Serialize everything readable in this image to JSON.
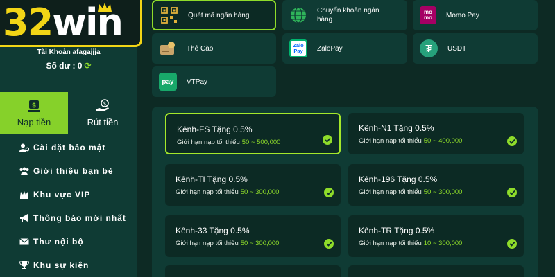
{
  "logo": {
    "part1": "32",
    "part2": "win"
  },
  "account": {
    "name": "Tài Khoản afagajjja",
    "balance_label": "Số dư : 0",
    "refresh_glyph": "⟳"
  },
  "tabs": {
    "deposit": "Nạp tiền",
    "withdraw": "Rút tiền"
  },
  "menu": [
    {
      "label": "Cài đặt bảo mật",
      "icon": "user-gear-icon"
    },
    {
      "label": "Giới thiệu bạn bè",
      "icon": "users-icon"
    },
    {
      "label": "Khu vực VIP",
      "icon": "vip-crown-icon"
    },
    {
      "label": "Thông báo mới nhất",
      "icon": "megaphone-icon"
    },
    {
      "label": "Thư nội bộ",
      "icon": "envelope-icon"
    },
    {
      "label": "Khu sự kiện",
      "icon": "trophy-icon"
    }
  ],
  "payment_methods": [
    {
      "label": "Quét mã ngân hàng",
      "icon": "qr-code-icon",
      "selected": true
    },
    {
      "label": "Chuyển khoản ngân hàng",
      "icon": "globe-icon",
      "selected": false
    },
    {
      "label": "Momo Pay",
      "icon": "momo-icon",
      "icon_text": "mo mo",
      "selected": false
    },
    {
      "label": "Thẻ Cào",
      "icon": "scratch-card-icon",
      "selected": false
    },
    {
      "label": "ZaloPay",
      "icon": "zalopay-icon",
      "icon_text": "Zalo Pay",
      "selected": false
    },
    {
      "label": "USDT",
      "icon": "tether-icon",
      "icon_text": "₮",
      "selected": false
    },
    {
      "label": "VTPay",
      "icon": "vtpay-icon",
      "icon_text": "pay",
      "selected": false
    }
  ],
  "channels": [
    {
      "title": "Kênh-FS Tặng 0.5%",
      "limit_label": "Giới hạn nạp tối thiểu",
      "range": "50 ~ 500,000",
      "selected": true
    },
    {
      "title": "Kênh-N1 Tặng 0.5%",
      "limit_label": "Giới hạn nạp tối thiểu",
      "range": "50 ~ 400,000",
      "selected": false
    },
    {
      "title": "Kênh-TI Tặng 0.5%",
      "limit_label": "Giới hạn nạp tối thiểu",
      "range": "50 ~ 300,000",
      "selected": false
    },
    {
      "title": "Kênh-196 Tặng 0.5%",
      "limit_label": "Giới hạn nạp tối thiểu",
      "range": "50 ~ 300,000",
      "selected": false
    },
    {
      "title": "Kênh-33 Tặng 0.5%",
      "limit_label": "Giới hạn nạp tối thiểu",
      "range": "50 ~ 300,000",
      "selected": false
    },
    {
      "title": "Kênh-TR Tặng 0.5%",
      "limit_label": "Giới hạn nạp tối thiểu",
      "range": "10 ~ 300,000",
      "selected": false
    }
  ],
  "colors": {
    "accent": "#8fdc2a",
    "brand_yellow": "#f2d516",
    "background": "#0d2a24",
    "panel": "#0f3b34",
    "card": "#0c2a24"
  }
}
